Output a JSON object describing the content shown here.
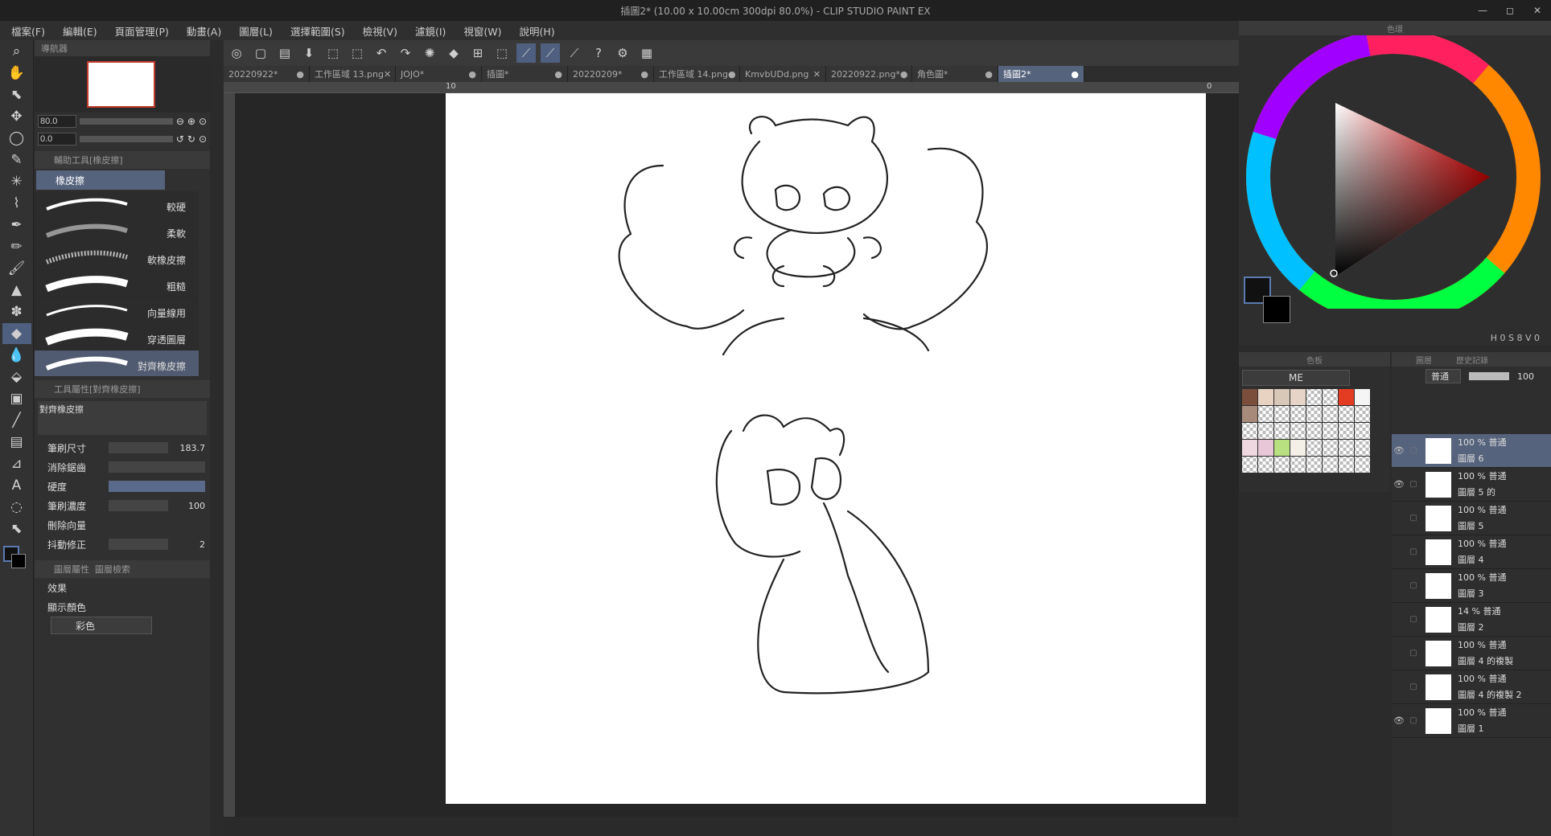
{
  "window": {
    "title": "插圖2* (10.00 x 10.00cm 300dpi 80.0%) - CLIP STUDIO PAINT EX",
    "minimize": "—",
    "maximize": "◻",
    "close": "✕"
  },
  "menu": [
    "檔案(F)",
    "編輯(E)",
    "頁面管理(P)",
    "動畫(A)",
    "圖層(L)",
    "選擇範圍(S)",
    "檢視(V)",
    "濾鏡(I)",
    "視窗(W)",
    "說明(H)"
  ],
  "tabs": [
    {
      "label": "20220922*",
      "close": "●"
    },
    {
      "label": "工作區域 13.png",
      "close": "✕"
    },
    {
      "label": "JOJO*",
      "close": "●"
    },
    {
      "label": "插圖*",
      "close": "●"
    },
    {
      "label": "20220209*",
      "close": "●"
    },
    {
      "label": "工作區域 14.png",
      "close": "●"
    },
    {
      "label": "KmvbUDd.png",
      "close": "✕"
    },
    {
      "label": "20220922.png*",
      "close": "●"
    },
    {
      "label": "角色圖*",
      "close": "●"
    },
    {
      "label": "插圖2*",
      "close": "●"
    }
  ],
  "ruler": {
    "left": "10",
    "right": "0"
  },
  "navigator": {
    "title": "導航器",
    "zoom": "80.0",
    "rotate": "0.0"
  },
  "subtool": {
    "title": "輔助工具[橡皮擦]",
    "group": "橡皮擦",
    "brushes": [
      "較硬",
      "柔軟",
      "軟橡皮擦",
      "粗糙",
      "向量線用",
      "穿透圖層",
      "對齊橡皮擦"
    ]
  },
  "toolprop": {
    "title": "工具屬性[對齊橡皮擦]",
    "preview_label": "對齊橡皮擦",
    "brush_size_label": "筆刷尺寸",
    "brush_size": "183.7",
    "antialias_label": "消除鋸齒",
    "hardness_label": "硬度",
    "density_label": "筆刷濃度",
    "density": "100",
    "vector_label": "刪除向量",
    "stabilize_label": "抖動修正",
    "stabilize": "2"
  },
  "layerprop": {
    "title": "圖層屬性",
    "title2": "圖層檢索",
    "effect_label": "效果",
    "display_color_label": "顯示顏色",
    "display_color": "彩色"
  },
  "colorpanel": {
    "title": "色環",
    "readout": "H 0 S 8 V 0"
  },
  "palette": {
    "title": "色板",
    "set": "ME"
  },
  "layers": {
    "tabs": [
      "圖層",
      "歷史記錄"
    ],
    "blend": "普通",
    "opacity": "100",
    "rows": [
      {
        "line1": "100 % 普通",
        "line2": "圖層 6",
        "visible": true,
        "selected": true
      },
      {
        "line1": "100 % 普通",
        "line2": "圖層 5 的",
        "visible": true,
        "selected": false
      },
      {
        "line1": "100 % 普通",
        "line2": "圖層 5",
        "visible": false,
        "selected": false
      },
      {
        "line1": "100 % 普通",
        "line2": "圖層 4",
        "visible": false,
        "selected": false
      },
      {
        "line1": "100 % 普通",
        "line2": "圖層 3",
        "visible": false,
        "selected": false
      },
      {
        "line1": "14 % 普通",
        "line2": "圖層 2",
        "visible": false,
        "selected": false
      },
      {
        "line1": "100 % 普通",
        "line2": "圖層 4 的複製",
        "visible": false,
        "selected": false
      },
      {
        "line1": "100 % 普通",
        "line2": "圖層 4 的複製 2",
        "visible": false,
        "selected": false
      },
      {
        "line1": "100 % 普通",
        "line2": "圖層 1",
        "visible": true,
        "selected": false
      }
    ]
  },
  "icons": {
    "eye": "👁",
    "lock": "▢",
    "check": "✓"
  },
  "swatch_colors": [
    "#7a4e3a",
    "#e8d3c2",
    "#d8c8b8",
    "#e6d4c8",
    "",
    "",
    "#e43c22",
    "#f5f5f5",
    "#a78a7a",
    "",
    "",
    "",
    "",
    "",
    "",
    "",
    "",
    "",
    "",
    "",
    "",
    "",
    "",
    "",
    "#f0d8e0",
    "#e8c8d8",
    "#b8e080",
    "#f4f0e8",
    "",
    "",
    "",
    "",
    "",
    "",
    "",
    "",
    "",
    "",
    "",
    ""
  ]
}
